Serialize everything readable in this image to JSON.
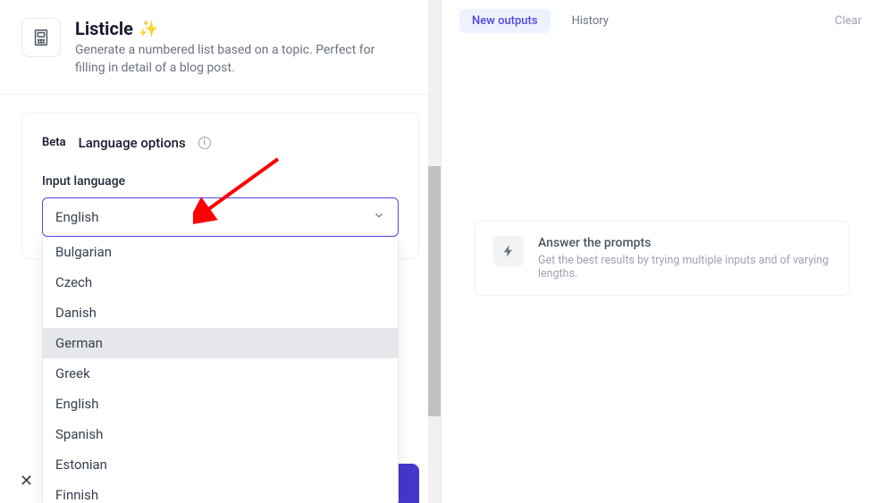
{
  "header": {
    "title": "Listicle",
    "sparkle_emoji": "✨",
    "description": "Generate a numbered list based on a topic. Perfect for filling in detail of a blog post."
  },
  "form": {
    "beta_label": "Beta",
    "section_title": "Language options",
    "field_label": "Input language",
    "selected_value": "English",
    "options": [
      {
        "label": "Bulgarian",
        "hover": false
      },
      {
        "label": "Czech",
        "hover": false
      },
      {
        "label": "Danish",
        "hover": false
      },
      {
        "label": "German",
        "hover": true
      },
      {
        "label": "Greek",
        "hover": false
      },
      {
        "label": "English",
        "hover": false
      },
      {
        "label": "Spanish",
        "hover": false
      },
      {
        "label": "Estonian",
        "hover": false
      },
      {
        "label": "Finnish",
        "hover": false
      }
    ]
  },
  "right": {
    "tab_new": "New outputs",
    "tab_history": "History",
    "clear_label": "Clear",
    "prompt_title": "Answer the prompts",
    "prompt_sub": "Get the best results by trying multiple inputs and of varying lengths."
  },
  "annotation": {
    "arrow_color": "#ff0000"
  }
}
